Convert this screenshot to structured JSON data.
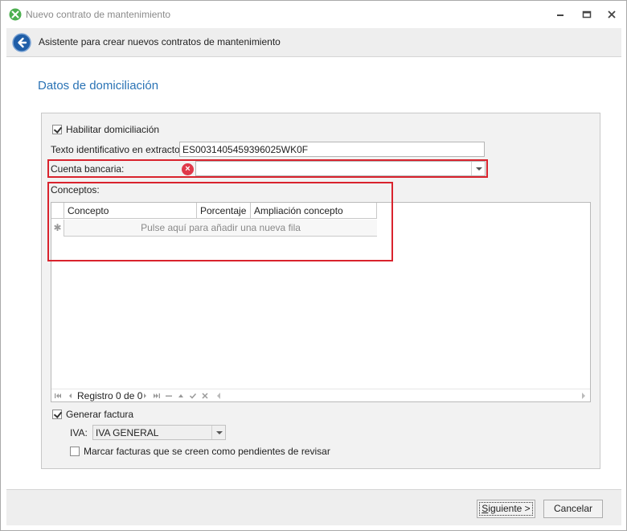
{
  "window": {
    "title": "Nuevo contrato de mantenimiento"
  },
  "header": {
    "title": "Asistente para crear nuevos contratos de mantenimiento"
  },
  "section": {
    "title": "Datos de domiciliación"
  },
  "form": {
    "habilitar_domiciliacion": {
      "label": "Habilitar domiciliación",
      "checked": true
    },
    "texto_extracto": {
      "label": "Texto identificativo en extracto:",
      "value": "ES0031405459396025WK0F"
    },
    "cuenta_bancaria": {
      "label": "Cuenta bancaria:",
      "value": ""
    },
    "conceptos": {
      "label": "Conceptos:",
      "columns": [
        "Concepto",
        "Porcentaje",
        "Ampliación concepto"
      ],
      "new_row_indicator": "✱",
      "new_row_text": "Pulse aquí para añadir una nueva fila",
      "navigator_text": "Registro 0 de 0"
    },
    "generar_factura": {
      "label": "Generar factura",
      "checked": true
    },
    "iva": {
      "label": "IVA:",
      "value": "IVA GENERAL"
    },
    "marcar_pendientes": {
      "label": "Marcar facturas que se creen como pendientes de revisar",
      "checked": false
    }
  },
  "footer": {
    "next_label_prefix": "S",
    "next_label_rest": "iguiente >",
    "cancel_label": "Cancelar"
  },
  "colors": {
    "accent": "#2a73b5",
    "error_frame": "#d9232d",
    "error_icon": "#e0394a"
  }
}
